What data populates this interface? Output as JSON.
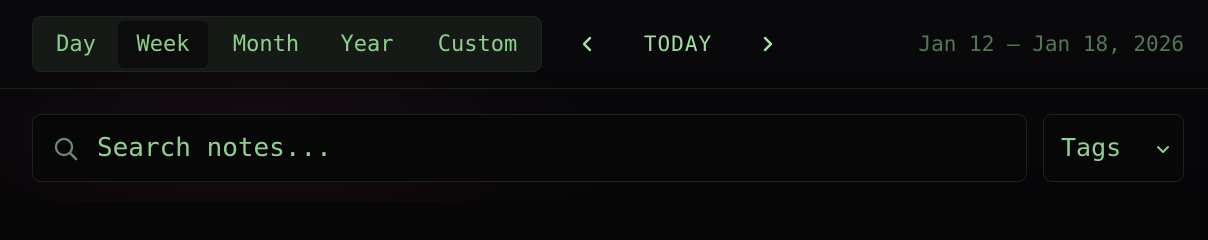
{
  "toolbar": {
    "view_modes": [
      {
        "label": "Day",
        "active": false
      },
      {
        "label": "Week",
        "active": true
      },
      {
        "label": "Month",
        "active": false
      },
      {
        "label": "Year",
        "active": false
      },
      {
        "label": "Custom",
        "active": false
      }
    ],
    "prev_icon": "chevron-left-icon",
    "next_icon": "chevron-right-icon",
    "today_label": "TODAY",
    "date_range": "Jan 12 — Jan 18, 2026"
  },
  "search": {
    "icon": "search-icon",
    "value": "",
    "placeholder": "Search notes..."
  },
  "tags_dropdown": {
    "label": "Tags",
    "icon": "chevron-down-icon"
  },
  "colors": {
    "accent": "#8fd08f",
    "muted_text": "#4f7a51",
    "background": "#070607",
    "segment_background": "#151a16",
    "border": "#1c221d"
  }
}
